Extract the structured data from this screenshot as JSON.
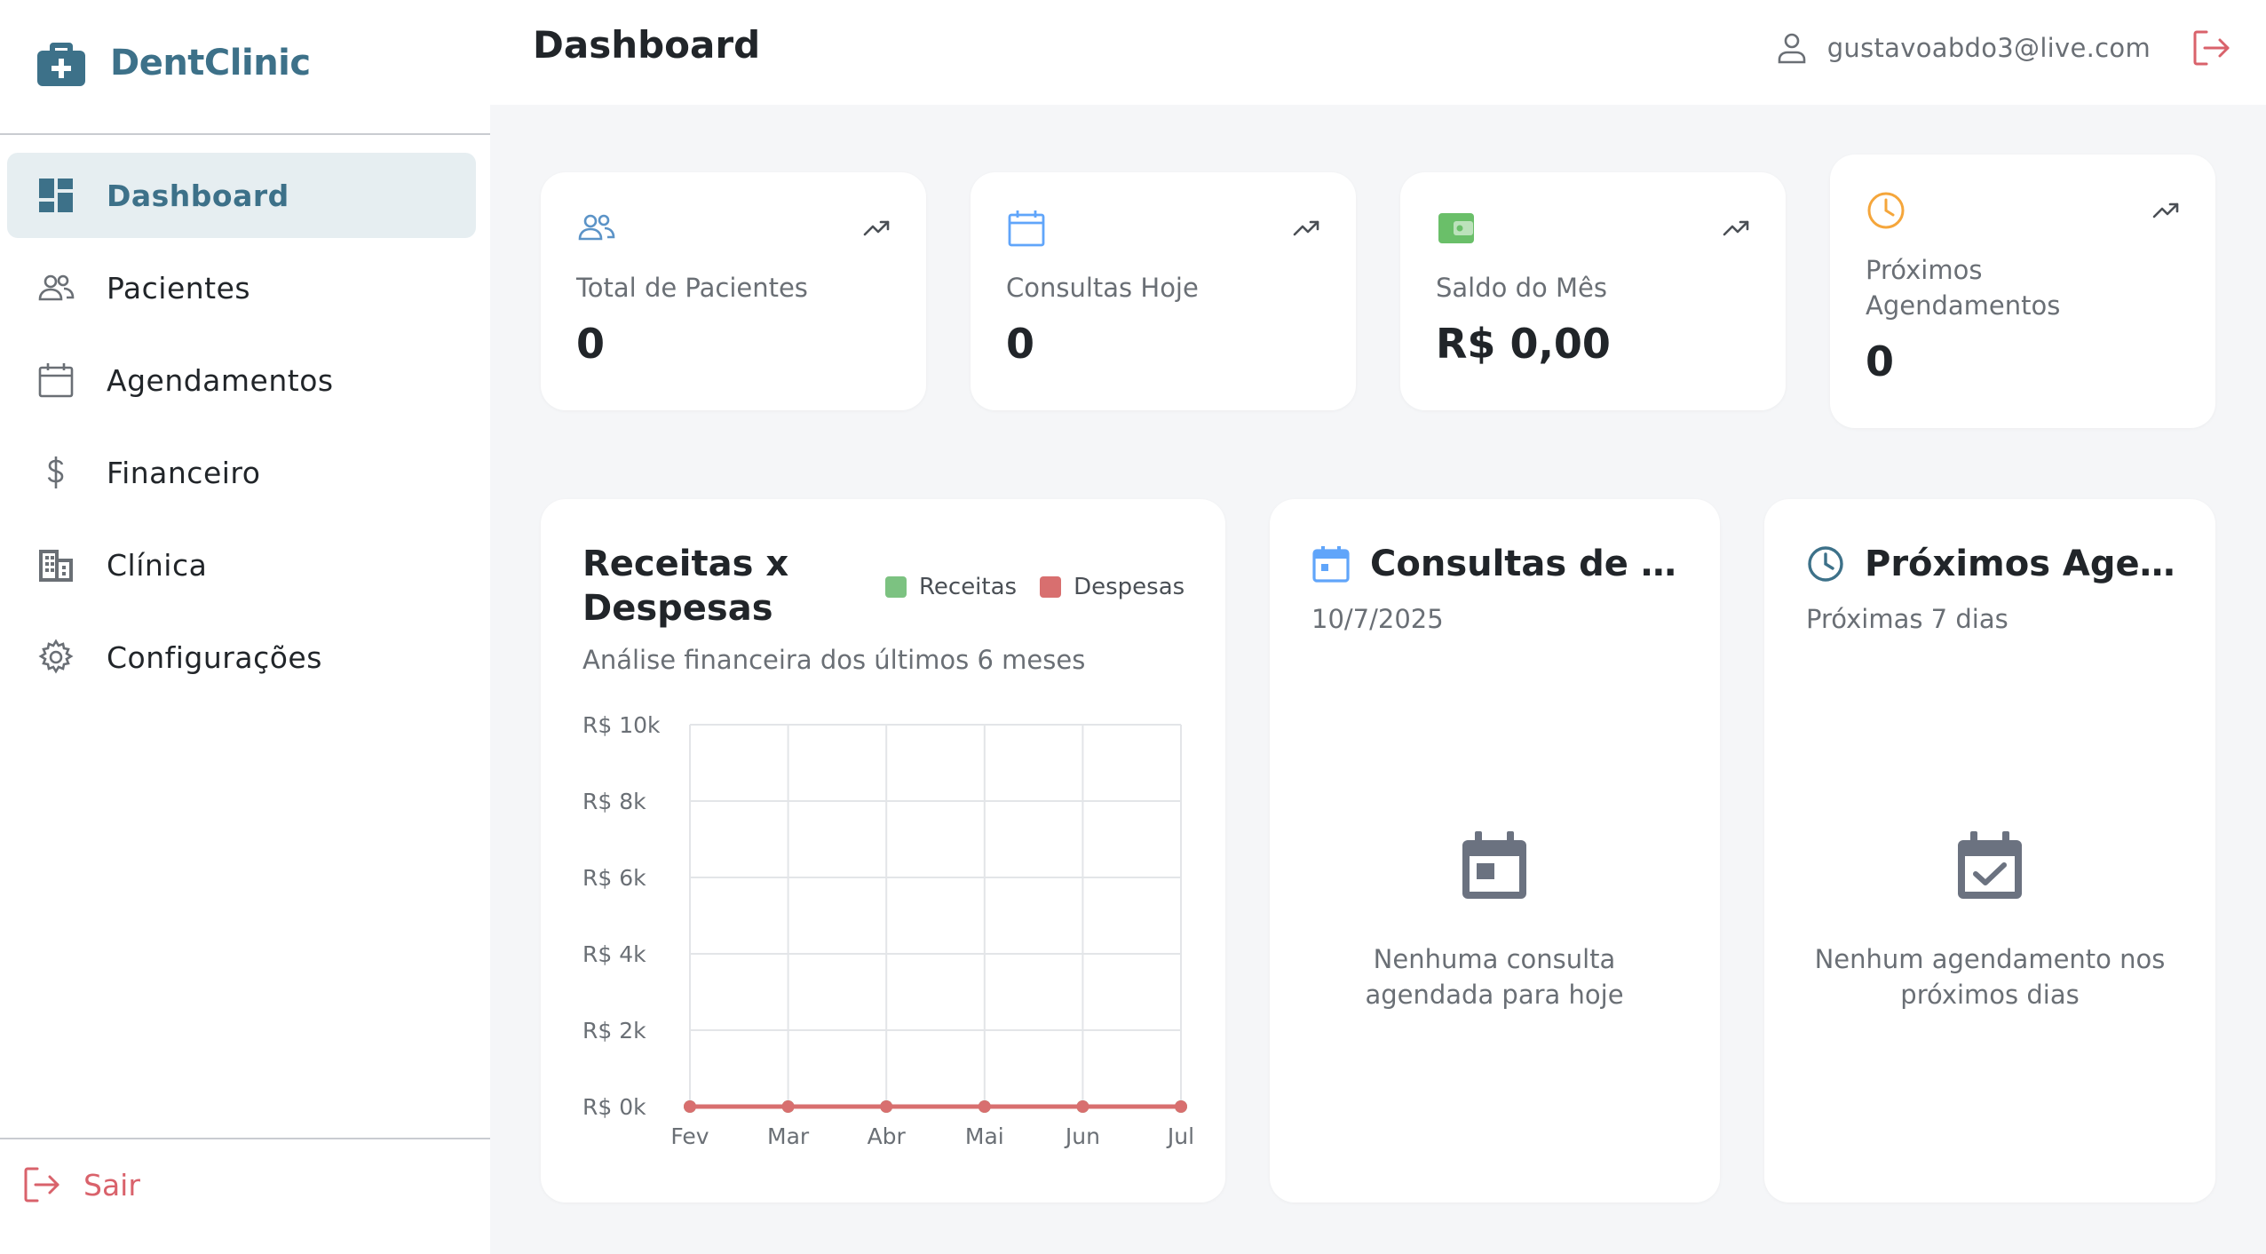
{
  "app": {
    "brand_name": "DentClinic"
  },
  "sidebar": {
    "items": [
      {
        "label": "Dashboard",
        "icon": "dashboard-icon",
        "active": true
      },
      {
        "label": "Pacientes",
        "icon": "users-icon"
      },
      {
        "label": "Agendamentos",
        "icon": "calendar-icon"
      },
      {
        "label": "Financeiro",
        "icon": "dollar-icon"
      },
      {
        "label": "Clínica",
        "icon": "building-icon"
      },
      {
        "label": "Configurações",
        "icon": "gear-icon"
      }
    ],
    "logout_label": "Sair"
  },
  "header": {
    "title": "Dashboard",
    "user_email": "gustavoabdo3@live.com"
  },
  "stats": [
    {
      "label": "Total de Pacientes",
      "value": "0",
      "icon": "users-icon",
      "color": "#5b93c7"
    },
    {
      "label": "Consultas Hoje",
      "value": "0",
      "icon": "calendar-icon",
      "color": "#60a5fa"
    },
    {
      "label": "Saldo do Mês",
      "value": "R$ 0,00",
      "icon": "wallet-icon",
      "color": "#6abf69"
    },
    {
      "label": "Próximos Agendamentos",
      "value": "0",
      "icon": "clock-icon",
      "color": "#f5a63b"
    }
  ],
  "finance": {
    "title": "Receitas x Despesas",
    "subtitle": "Análise financeira dos últimos 6 meses",
    "legend": [
      {
        "label": "Receitas",
        "color": "#7cc281"
      },
      {
        "label": "Despesas",
        "color": "#d86f6f"
      }
    ]
  },
  "chart_data": {
    "type": "line",
    "categories": [
      "Fev",
      "Mar",
      "Abr",
      "Mai",
      "Jun",
      "Jul"
    ],
    "series": [
      {
        "name": "Receitas",
        "values": [
          0,
          0,
          0,
          0,
          0,
          0
        ],
        "color": "#7cc281"
      },
      {
        "name": "Despesas",
        "values": [
          0,
          0,
          0,
          0,
          0,
          0
        ],
        "color": "#d86f6f"
      }
    ],
    "y_ticks": [
      "R$ 0k",
      "R$ 2k",
      "R$ 4k",
      "R$ 6k",
      "R$ 8k",
      "R$ 10k"
    ],
    "ylim": [
      0,
      10000
    ],
    "grid": true,
    "legend_position": "top-right"
  },
  "today": {
    "title": "Consultas de Hoje",
    "date": "10/7/2025",
    "empty_text": "Nenhuma consulta agendada para hoje"
  },
  "upcoming": {
    "title": "Próximos Agendamentos",
    "subtitle": "Próximas 7 dias",
    "empty_text": "Nenhum agendamento nos próximos dias"
  }
}
